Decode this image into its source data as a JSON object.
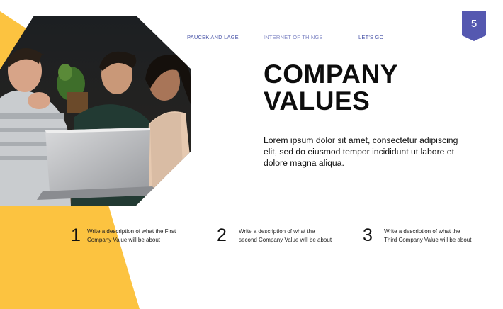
{
  "nav": {
    "item1": "PAUCEK AND LAGE",
    "item2": "INTERNET OF THINGS",
    "item3": "LET'S GO"
  },
  "page_number": "5",
  "title": {
    "line1": "COMPANY",
    "line2": "VALUES"
  },
  "description": {
    "line1": "Lorem ipsum dolor sit amet, consectetur adipiscing",
    "line2": "elit, sed do eiusmod tempor incididunt ut labore et",
    "line3": "dolore magna aliqua."
  },
  "values": [
    {
      "number": "1",
      "line1": "Write a description of what the First",
      "line2": "Company Value will be about"
    },
    {
      "number": "2",
      "line1": "Write a description of what the",
      "line2": "second  Company Value will be about"
    },
    {
      "number": "3",
      "line1": "Write a description of what the",
      "line2": "Third Company Value will be about"
    }
  ],
  "colors": {
    "accent_yellow": "#fcc340",
    "accent_blue": "#5558b0",
    "rule_blue": "#7c86c0",
    "rule_yellow": "#fcd57a"
  },
  "photo": {
    "icon": "team-photo",
    "subject": "three people looking at a laptop"
  }
}
